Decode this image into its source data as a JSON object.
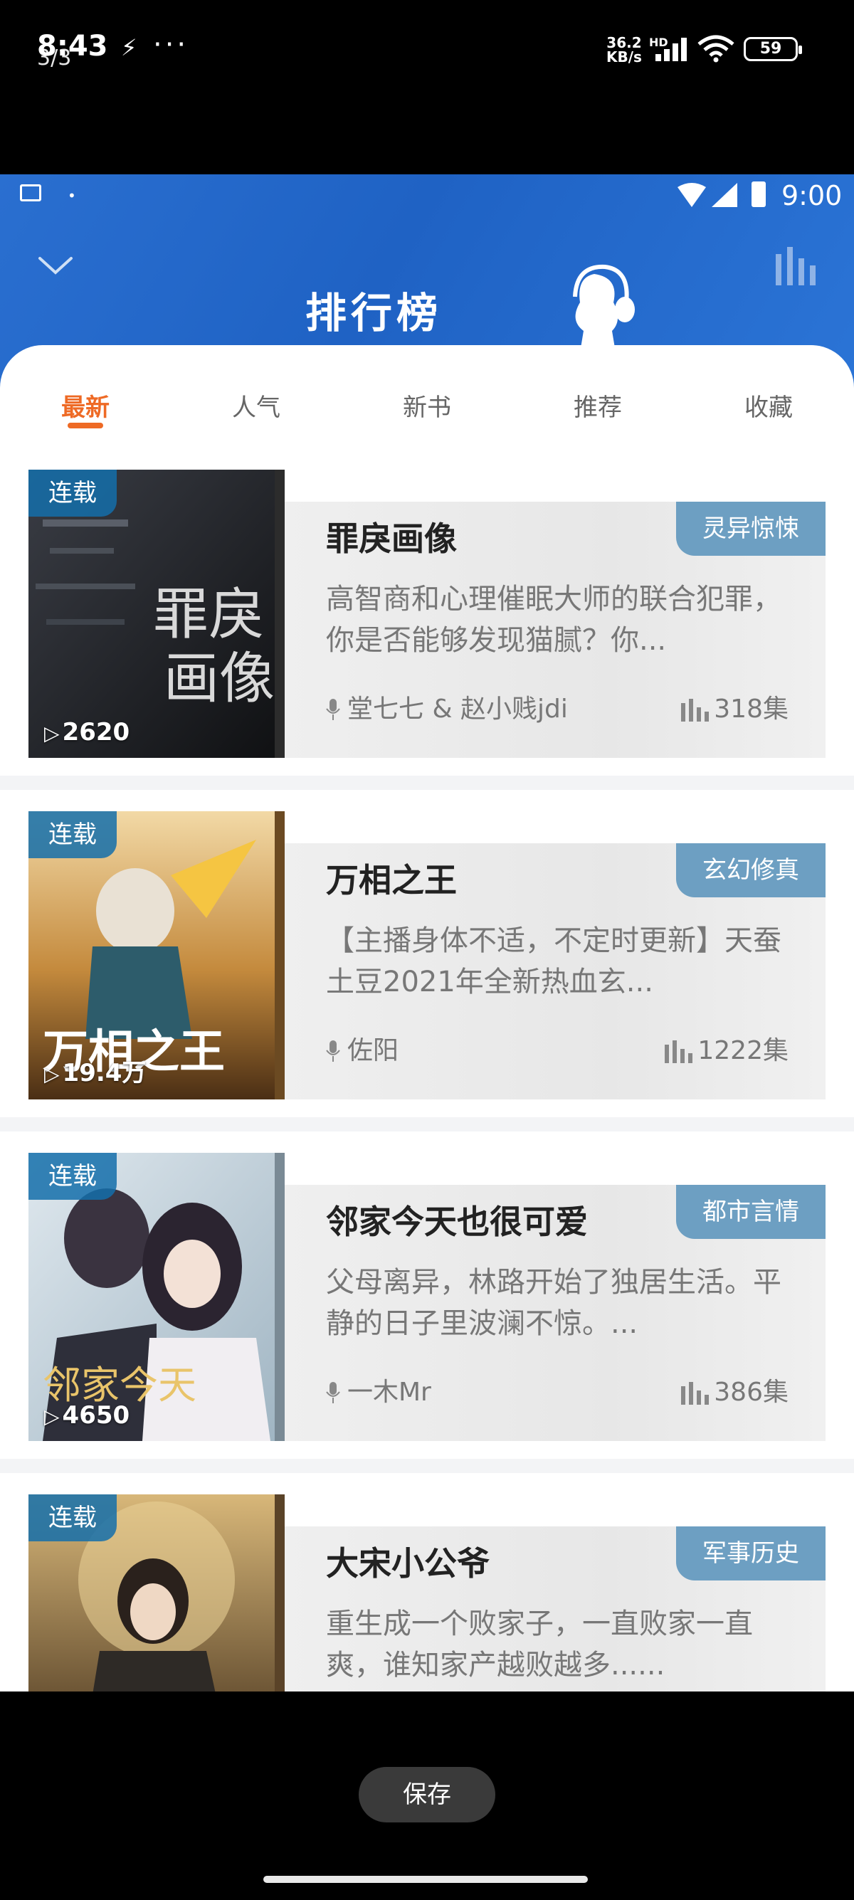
{
  "outer_status": {
    "time": "8:43",
    "page_indicator": "3/3",
    "network_speed": "36.2",
    "network_unit": "KB/s",
    "hd_label": "HD",
    "battery": "59"
  },
  "inner_status": {
    "time": "9:00"
  },
  "header": {
    "title": "排行榜"
  },
  "tabs": [
    {
      "label": "最新",
      "active": true
    },
    {
      "label": "人气"
    },
    {
      "label": "新书"
    },
    {
      "label": "推荐"
    },
    {
      "label": "收藏"
    }
  ],
  "books": [
    {
      "status_badge": "连载",
      "plays": "2620",
      "title": "罪戾画像",
      "genre": "灵异惊悚",
      "description": "高智商和心理催眠大师的联合犯罪，你是否能够发现猫腻？你...",
      "hosts": "堂七七 & 赵小贱jdi",
      "episodes": "318集"
    },
    {
      "status_badge": "连载",
      "plays": "19.4万",
      "title": "万相之王",
      "genre": "玄幻修真",
      "description": "【主播身体不适，不定时更新】天蚕土豆2021年全新热血玄...",
      "hosts": "佐阳",
      "episodes": "1222集"
    },
    {
      "status_badge": "连载",
      "plays": "4650",
      "title": "邻家今天也很可爱",
      "genre": "都市言情",
      "description": "父母离异，林路开始了独居生活。平静的日子里波澜不惊。...",
      "hosts": "一木Mr",
      "episodes": "386集"
    },
    {
      "status_badge": "连载",
      "plays": "",
      "title": "大宋小公爷",
      "genre": "军事历史",
      "description": "重生成一个败家子，一直败家一直爽，谁知家产越败越多......",
      "hosts": "",
      "episodes": ""
    }
  ],
  "bottom": {
    "save_label": "保存"
  },
  "colors": {
    "accent": "#ee6a25",
    "header_blue": "#2a6fd0",
    "genre_tag": "#6d9fc2"
  }
}
